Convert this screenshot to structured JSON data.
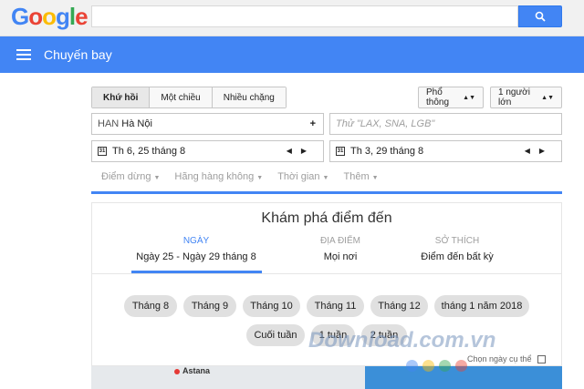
{
  "google": {
    "logo": "Google",
    "search_placeholder": ""
  },
  "appbar": {
    "title": "Chuyến bay"
  },
  "trip_type": {
    "tabs": [
      "Khứ hồi",
      "Một chiều",
      "Nhiều chặng"
    ],
    "active": 0
  },
  "cabin_class": "Phổ thông",
  "passengers": "1 người lớn",
  "origin": {
    "code": "HAN",
    "city": "Hà Nội",
    "add_symbol": "+"
  },
  "destination": {
    "placeholder": "Thử \"LAX, SNA, LGB\""
  },
  "depart_date": "Th 6, 25 tháng 8",
  "return_date": "Th 3, 29 tháng 8",
  "calendar_icon_text": "31",
  "filters": [
    "Điểm dừng",
    "Hãng hàng không",
    "Thời gian",
    "Thêm"
  ],
  "explore": {
    "title": "Khám phá điểm đến",
    "tabs": [
      {
        "heading": "NGÀY",
        "value": "Ngày 25 - Ngày 29 tháng 8"
      },
      {
        "heading": "ĐỊA ĐIỂM",
        "value": "Mọi nơi"
      },
      {
        "heading": "SỞ THÍCH",
        "value": "Điểm đến bất kỳ"
      }
    ],
    "chips_row1": [
      "Tháng 8",
      "Tháng 9",
      "Tháng 10",
      "Tháng 11",
      "Tháng 12",
      "tháng 1 năm 2018"
    ],
    "chips_row2": [
      "Cuối tuần",
      "1 tuần",
      "2 tuần"
    ],
    "specific_dates": "Chọn ngày cụ thể"
  },
  "map": {
    "city": "Astana"
  },
  "watermark": "Download.com.vn",
  "colors": {
    "google_blue": "#4285f4",
    "chip_bg": "#e0e0e0"
  }
}
